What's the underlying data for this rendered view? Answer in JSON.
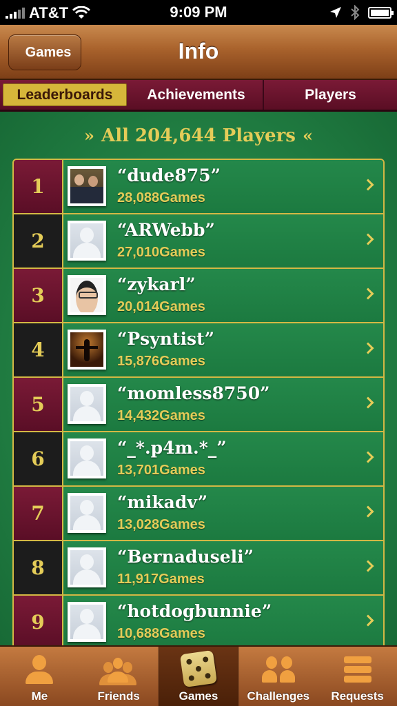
{
  "status_bar": {
    "carrier": "AT&T",
    "time": "9:09 PM"
  },
  "nav": {
    "back_label": "Games",
    "title": "Info"
  },
  "segments": [
    "Leaderboards",
    "Achievements",
    "Players"
  ],
  "leaderboard": {
    "header": "All 204,644 Players",
    "rows": [
      {
        "rank": "1",
        "name": "“dude875”",
        "score": "28,088Games",
        "avatar": "dude"
      },
      {
        "rank": "2",
        "name": "“ARWebb”",
        "score": "27,010Games",
        "avatar": "default"
      },
      {
        "rank": "3",
        "name": "“zykarl”",
        "score": "20,014Games",
        "avatar": "zykarl"
      },
      {
        "rank": "4",
        "name": "“Psyntist”",
        "score": "15,876Games",
        "avatar": "psyntist"
      },
      {
        "rank": "5",
        "name": "“momless8750”",
        "score": "14,432Games",
        "avatar": "default"
      },
      {
        "rank": "6",
        "name": "“_*.p4m.*_”",
        "score": "13,701Games",
        "avatar": "default"
      },
      {
        "rank": "7",
        "name": "“mikadv”",
        "score": "13,028Games",
        "avatar": "default"
      },
      {
        "rank": "8",
        "name": "“Bernaduseli”",
        "score": "11,917Games",
        "avatar": "default"
      },
      {
        "rank": "9",
        "name": "“hotdogbunnie”",
        "score": "10,688Games",
        "avatar": "default"
      }
    ]
  },
  "tabbar": [
    {
      "label": "Me",
      "icon": "me-icon"
    },
    {
      "label": "Friends",
      "icon": "friends-icon"
    },
    {
      "label": "Games",
      "icon": "games-dice-icon"
    },
    {
      "label": "Challenges",
      "icon": "challenges-icon"
    },
    {
      "label": "Requests",
      "icon": "requests-icon"
    }
  ],
  "colors": {
    "felt_green": "#1f7a40",
    "gold": "#e4cc58",
    "maroon": "#7a1a36",
    "wood": "#a9622c"
  }
}
